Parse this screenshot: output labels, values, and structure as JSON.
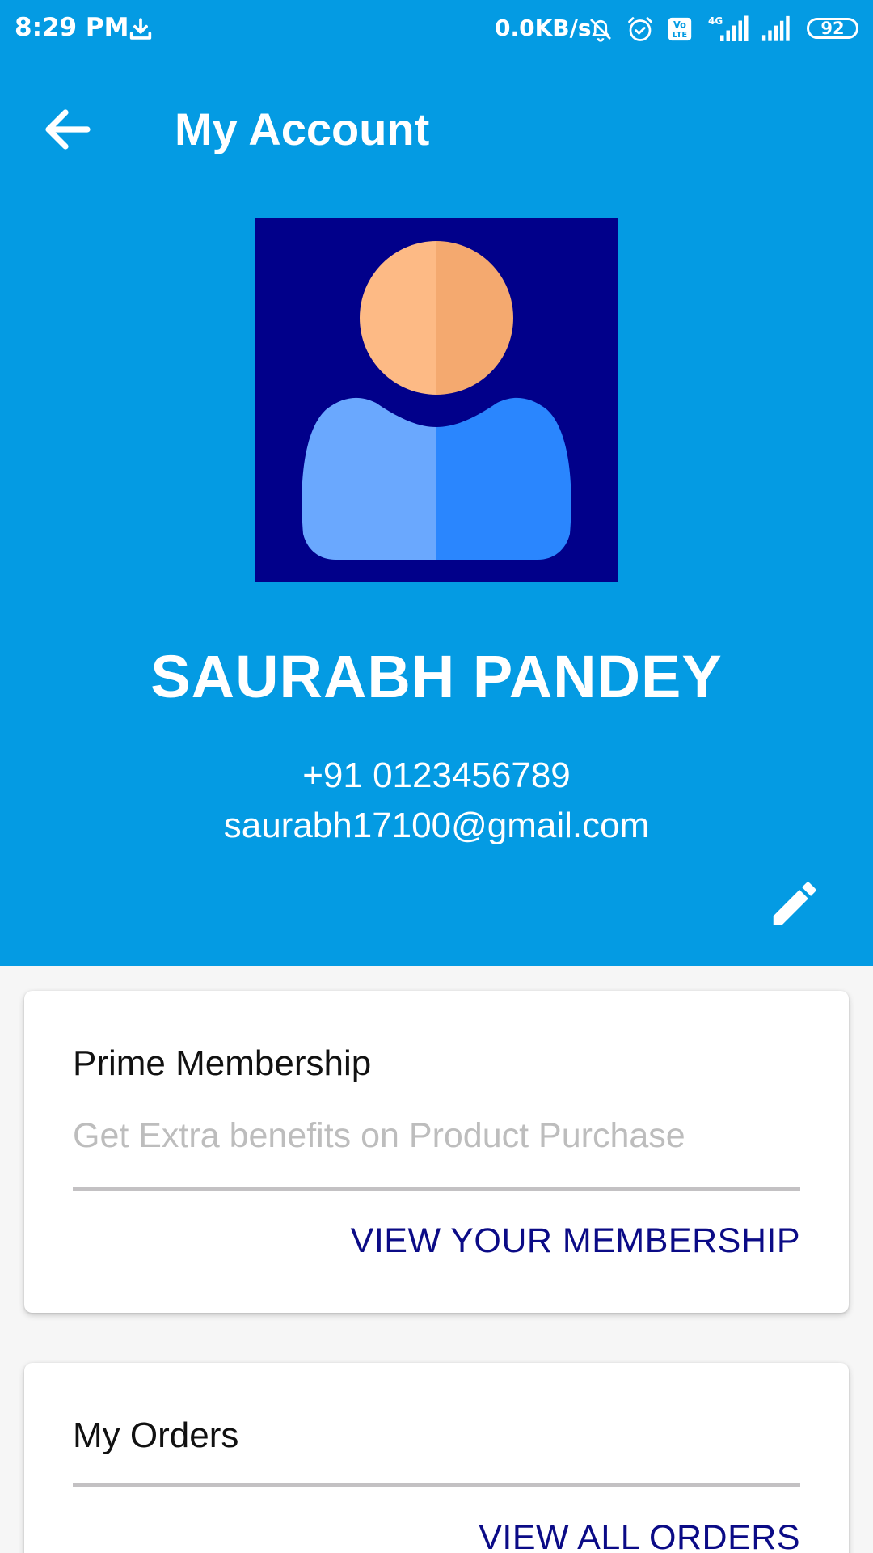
{
  "status_bar": {
    "time": "8:29 PM",
    "net_speed": "0.0KB/s",
    "network_type": "4G",
    "volte_label": "Vo LTE",
    "battery": "92",
    "icons": [
      "download-icon",
      "bell-off-icon",
      "alarm-icon",
      "volte-icon",
      "signal-icon",
      "signal-icon-2",
      "battery-icon"
    ]
  },
  "app_bar": {
    "title": "My Account",
    "back_icon": "arrow-back-icon"
  },
  "profile": {
    "name": "SAURABH PANDEY",
    "phone": "+91 0123456789",
    "email": "saurabh17100@gmail.com",
    "avatar_icon": "user-avatar-icon",
    "edit_icon": "pencil-icon"
  },
  "cards": {
    "membership": {
      "title": "Prime Membership",
      "subtitle": "Get Extra benefits on Product Purchase",
      "action": "VIEW YOUR MEMBERSHIP"
    },
    "orders": {
      "title": "My Orders",
      "action": "VIEW ALL ORDERS"
    }
  },
  "colors": {
    "primary": "#049be3",
    "avatar_bg": "#01008a",
    "action_text": "#0b0b86",
    "subtitle_text": "#bdbdbd"
  }
}
